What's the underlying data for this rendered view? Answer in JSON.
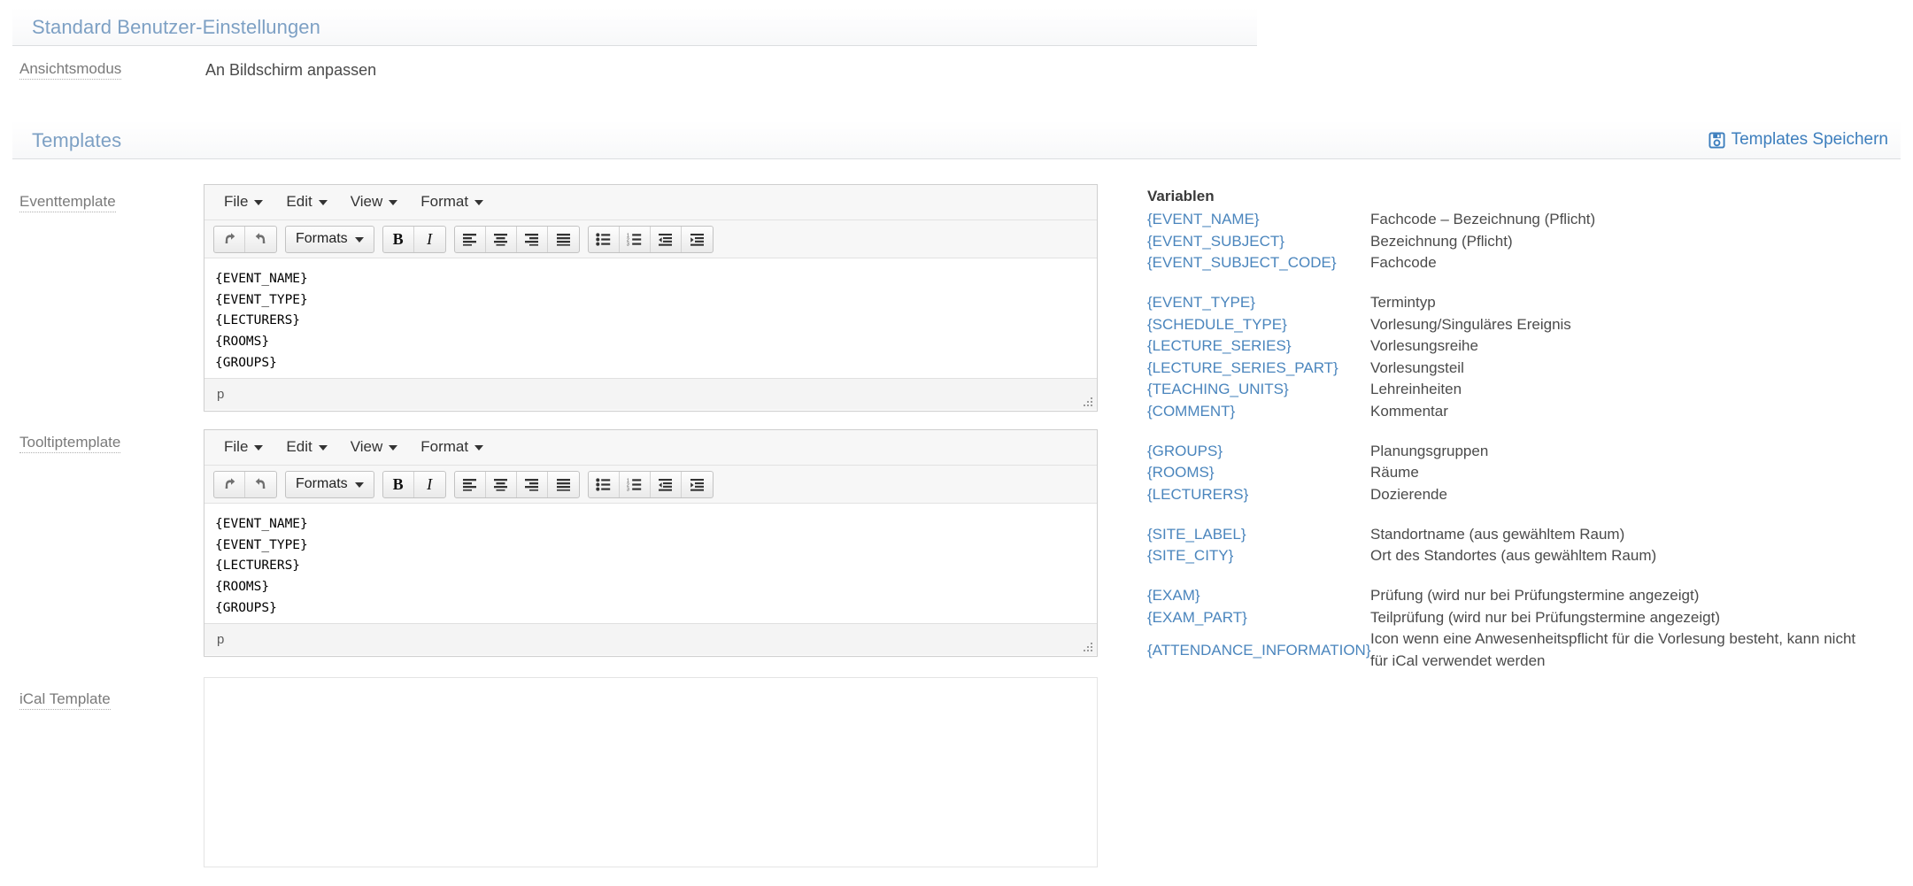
{
  "sections": {
    "user_settings": {
      "title": "Standard Benutzer-Einstellungen",
      "fields": [
        {
          "label": "Ansichtsmodus",
          "value": "An Bildschirm anpassen"
        }
      ]
    },
    "templates": {
      "title": "Templates",
      "save_label": "Templates Speichern",
      "save_icon": "floppy-save-icon"
    }
  },
  "editors": {
    "event": {
      "label": "Eventtemplate",
      "content": "{EVENT_NAME}\n{EVENT_TYPE}\n{LECTURERS}\n{ROOMS}\n{GROUPS}",
      "status_path": "p"
    },
    "tooltip": {
      "label": "Tooltiptemplate",
      "content": "{EVENT_NAME}\n{EVENT_TYPE}\n{LECTURERS}\n{ROOMS}\n{GROUPS}",
      "status_path": "p"
    },
    "ical": {
      "label": "iCal Template",
      "content": "",
      "placeholder": ""
    },
    "menubar": [
      {
        "label": "File"
      },
      {
        "label": "Edit"
      },
      {
        "label": "View"
      },
      {
        "label": "Format"
      }
    ],
    "toolbar": {
      "undo": "undo-icon",
      "redo": "redo-icon",
      "formats_label": "Formats",
      "bold": "B",
      "italic": "I",
      "align_left": "align-left-icon",
      "align_center": "align-center-icon",
      "align_right": "align-right-icon",
      "align_justify": "align-justify-icon",
      "bullet_list": "bullet-list-icon",
      "numbered_list": "numbered-list-icon",
      "outdent": "outdent-icon",
      "indent": "indent-icon"
    }
  },
  "variables": {
    "title": "Variablen",
    "groups": [
      {
        "rows": [
          {
            "key": "{EVENT_NAME}",
            "desc": "Fachcode – Bezeichnung (Pflicht)"
          },
          {
            "key": "{EVENT_SUBJECT}",
            "desc": "Bezeichnung (Pflicht)"
          },
          {
            "key": "{EVENT_SUBJECT_CODE}",
            "desc": "Fachcode"
          }
        ]
      },
      {
        "rows": [
          {
            "key": "{EVENT_TYPE}",
            "desc": "Termintyp"
          },
          {
            "key": "{SCHEDULE_TYPE}",
            "desc": "Vorlesung/Singuläres Ereignis"
          },
          {
            "key": "{LECTURE_SERIES}",
            "desc": "Vorlesungsreihe"
          },
          {
            "key": "{LECTURE_SERIES_PART}",
            "desc": "Vorlesungsteil"
          },
          {
            "key": "{TEACHING_UNITS}",
            "desc": "Lehreinheiten"
          },
          {
            "key": "{COMMENT}",
            "desc": "Kommentar"
          }
        ]
      },
      {
        "rows": [
          {
            "key": "{GROUPS}",
            "desc": "Planungsgruppen"
          },
          {
            "key": "{ROOMS}",
            "desc": "Räume"
          },
          {
            "key": "{LECTURERS}",
            "desc": "Dozierende"
          }
        ]
      },
      {
        "rows": [
          {
            "key": "{SITE_LABEL}",
            "desc": "Standortname (aus gewähltem Raum)"
          },
          {
            "key": "{SITE_CITY}",
            "desc": "Ort des Standortes (aus gewähltem Raum)"
          }
        ]
      },
      {
        "rows": [
          {
            "key": "{EXAM}",
            "desc": "Prüfung (wird nur bei Prüfungstermine angezeigt)"
          },
          {
            "key": "{EXAM_PART}",
            "desc": "Teilprüfung (wird nur bei Prüfungstermine angezeigt)"
          },
          {
            "key": "{ATTENDANCE_INFORMATION}",
            "desc": "Icon wenn eine Anwesenheitspflicht für die Vorlesung besteht, kann nicht für iCal verwendet werden"
          }
        ]
      }
    ]
  },
  "colors": {
    "header_blue": "#7da0c4",
    "link_blue": "#4a85bd",
    "label_gray": "#7a7a7a",
    "text_gray": "#4b4b4b"
  }
}
